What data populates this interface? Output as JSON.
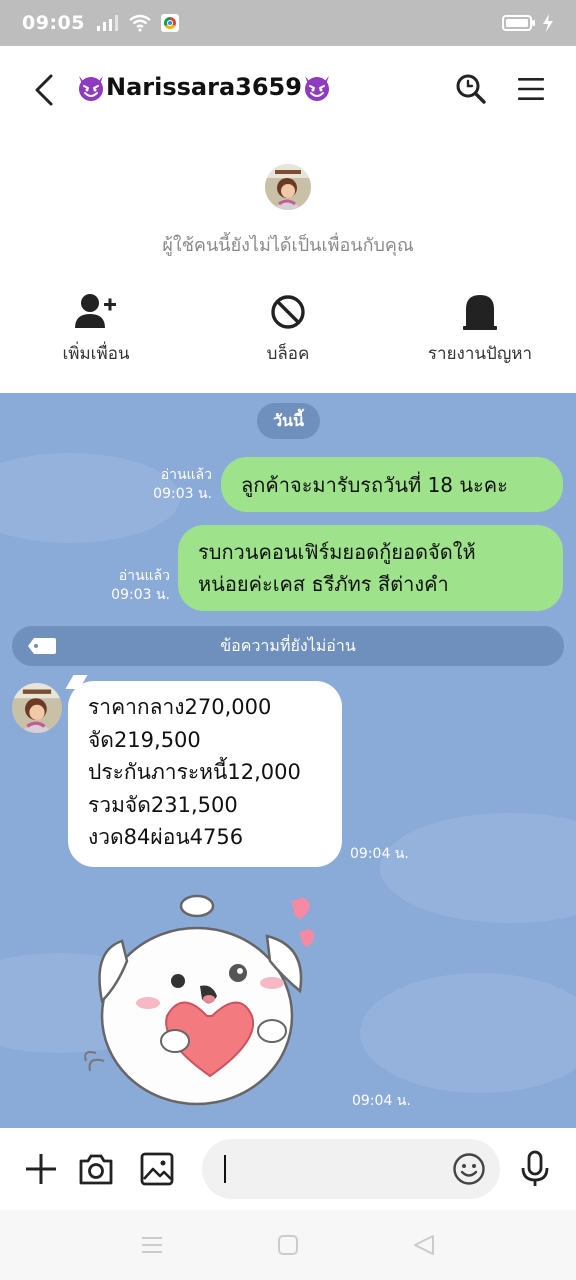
{
  "status_bar": {
    "time": "09:05"
  },
  "header": {
    "title": "Narissara3659",
    "title_emoji": "smiling-devil-icon"
  },
  "profile": {
    "notice": "ผู้ใช้คนนี้ยังไม่ได้เป็นเพื่อนกับคุณ",
    "actions": [
      {
        "label": "เพิ่มเพื่อน",
        "icon": "add-friend-icon"
      },
      {
        "label": "บล็อค",
        "icon": "block-icon"
      },
      {
        "label": "รายงานปัญหา",
        "icon": "report-icon"
      }
    ]
  },
  "chat": {
    "date_label": "วันนี้",
    "outgoing": [
      {
        "text": "ลูกค้าจะมารับรถวันที่ 18 นะคะ",
        "read": "อ่านแล้ว",
        "time": "09:03 น."
      },
      {
        "lines": [
          "รบกวนคอนเฟิร์มยอดกู้ยอดจัดให้",
          "หน่อยค่ะเคส ธรีภัทร สีต่างคำ"
        ],
        "read": "อ่านแล้ว",
        "time": "09:03 น."
      }
    ],
    "unread_label": "ข้อความที่ยังไม่อ่าน",
    "incoming": {
      "lines": [
        "ราคากลาง270,000",
        "จัด219,500",
        "ประกันภาระหนี้12,000",
        "รวมจัด231,500",
        "งวด84ผ่อน4756"
      ],
      "time": "09:04 น."
    },
    "sticker": {
      "icon": "puppy-heart-sticker",
      "time": "09:04 น."
    }
  },
  "input": {
    "value": "",
    "placeholder": ""
  },
  "colors": {
    "chat_bg": "#8aaad8",
    "outgoing_bubble": "#9ee28b",
    "pill": "#6f8fbd"
  }
}
